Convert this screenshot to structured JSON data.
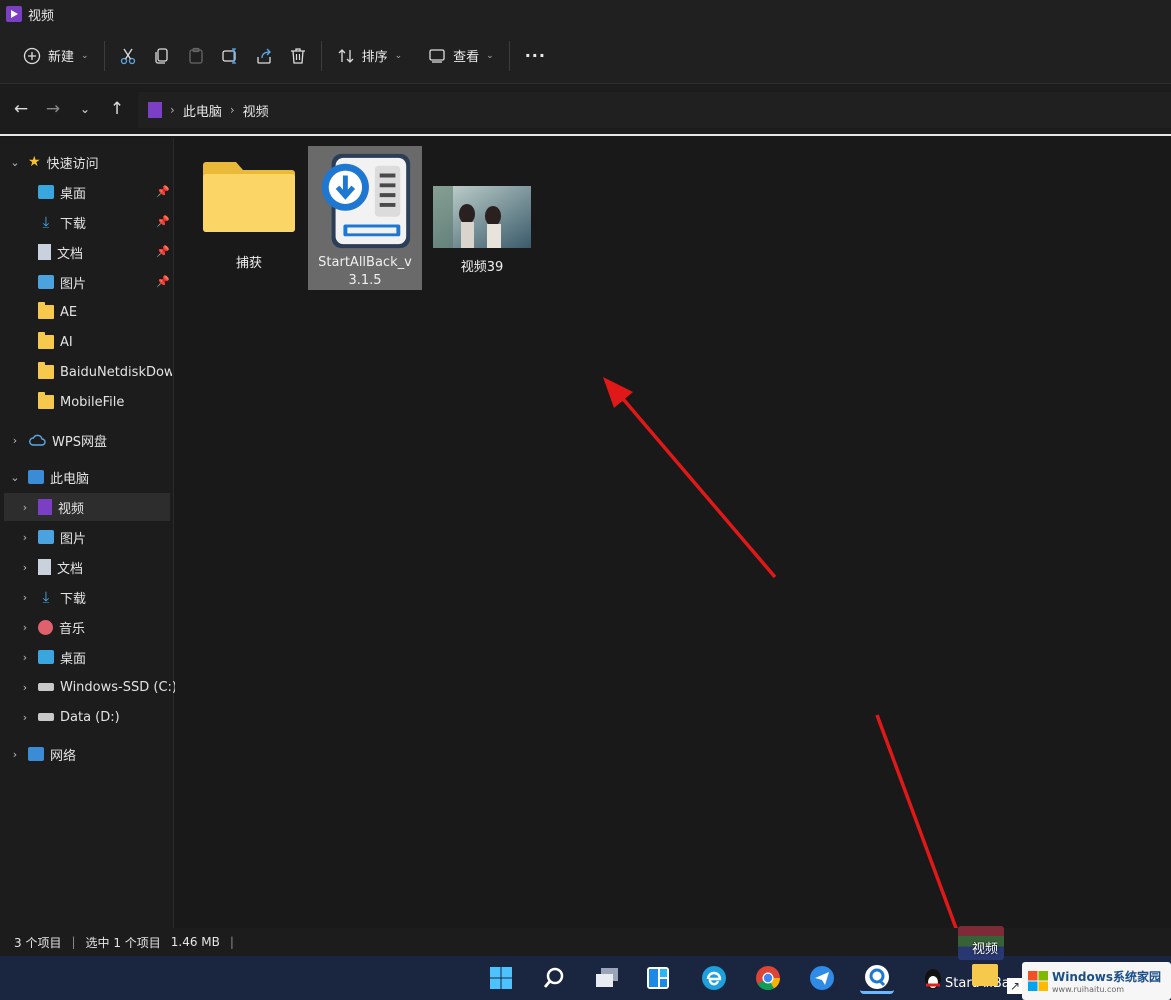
{
  "window": {
    "title": "视频"
  },
  "toolbar": {
    "new_label": "新建",
    "sort_label": "排序",
    "view_label": "查看",
    "more_label": "···"
  },
  "address": {
    "crumbs": [
      "此电脑",
      "视频"
    ]
  },
  "sidebar": {
    "quick_access": "快速访问",
    "quick_items": [
      "桌面",
      "下载",
      "文档",
      "图片",
      "AE",
      "AI",
      "BaiduNetdiskDow",
      "MobileFile"
    ],
    "wps": "WPS网盘",
    "this_pc": "此电脑",
    "pc_items": [
      "视频",
      "图片",
      "文档",
      "下载",
      "音乐",
      "桌面",
      "Windows-SSD (C:)",
      "Data (D:)"
    ],
    "network": "网络"
  },
  "files": [
    {
      "name": "捕获",
      "type": "folder"
    },
    {
      "name": "StartAllBack_v3.1.5",
      "type": "installer",
      "selected": true
    },
    {
      "name": "视频39",
      "type": "video"
    }
  ],
  "status": {
    "count": "3 个项目",
    "selected": "选中 1 个项目",
    "size": "1.46 MB"
  },
  "taskbar": {
    "preview_label": "视频",
    "app_label": "StartAllBa",
    "watermark_line1": "Windows系统家园",
    "watermark_line2": "www.ruihaitu.com"
  },
  "colors": {
    "accent": "#7a3fc4",
    "arrow": "#e01818",
    "taskbar": "#1a2540"
  }
}
